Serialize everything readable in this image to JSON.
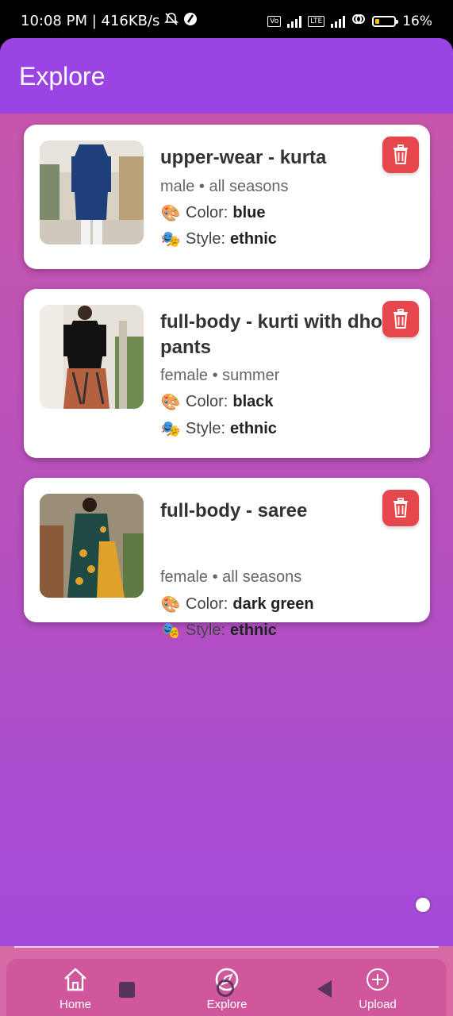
{
  "status_bar": {
    "time_speed": "10:08 PM | 416KB/s",
    "battery": "16%",
    "icons": [
      "mute-bell-icon",
      "app-icon",
      "volte-icon",
      "signal-icon",
      "lte-icon",
      "signal-icon",
      "link-icon",
      "battery-icon"
    ]
  },
  "header": {
    "title": "Explore"
  },
  "items": [
    {
      "title": "upper-wear - kurta",
      "meta": "male • all seasons",
      "color_label": "Color:",
      "color_value": "blue",
      "style_label": "Style:",
      "style_value": "ethnic",
      "image": "man-in-blue-kurta"
    },
    {
      "title": "full-body - kurti with dhoti pants",
      "meta": "female • summer",
      "color_label": "Color:",
      "color_value": "black",
      "style_label": "Style:",
      "style_value": "ethnic",
      "image": "woman-in-black-kurti"
    },
    {
      "title": "full-body - saree",
      "meta": "female • all seasons",
      "color_label": "Color:",
      "color_value": "dark green",
      "style_label": "Style:",
      "style_value": "ethnic",
      "image": "woman-in-green-saree"
    }
  ],
  "nav": {
    "home": "Home",
    "explore": "Explore",
    "upload": "Upload"
  },
  "colors": {
    "header": "#9b44e4",
    "delete": "#e5474c",
    "nav": "#d0579c"
  }
}
